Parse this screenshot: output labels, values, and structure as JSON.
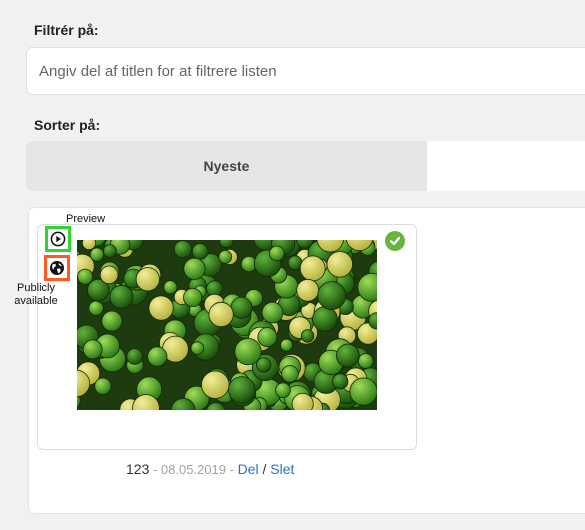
{
  "filter": {
    "label": "Filtrér på:",
    "placeholder": "Angiv del af titlen for at filtrere listen",
    "value": ""
  },
  "sort": {
    "label": "Sorter på:",
    "active_tab": "Nyeste",
    "other_tab": ""
  },
  "media_item": {
    "id": "123",
    "separator1": " - ",
    "date": "08.05.2019",
    "separator2": " - ",
    "share_label": "Del",
    "slash": " / ",
    "delete_label": "Slet",
    "selected": true
  },
  "annotations": {
    "preview": "Preview",
    "publicly_available": "Publicly available"
  },
  "colors": {
    "page_background": "#f1f1f1",
    "link": "#2a73c4",
    "check": "#6bb33f",
    "preview_highlight": "#2fd52f",
    "public_highlight": "#ff5a1f"
  },
  "icons": {
    "preview": "play-circle-icon",
    "public": "globe-icon",
    "selected": "check-circle-icon"
  }
}
